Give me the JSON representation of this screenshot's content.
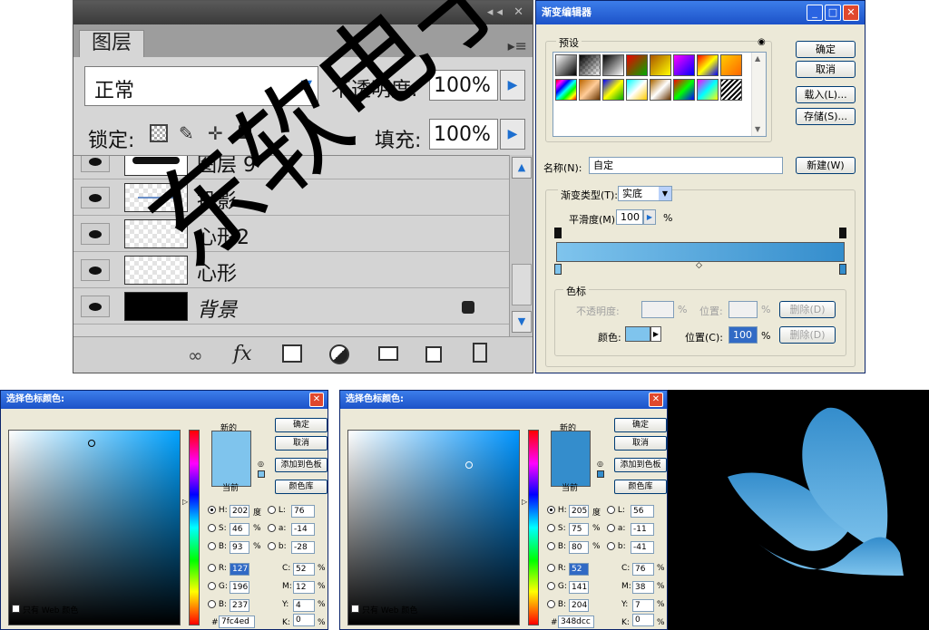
{
  "layers_panel": {
    "tab_label": "图层",
    "blend_mode": "正常",
    "opacity_label": "不透明度:",
    "opacity_value": "100%",
    "lock_label": "锁定:",
    "fill_label": "填充:",
    "fill_value": "100%",
    "layers": [
      {
        "name": "图层 9"
      },
      {
        "name": "投影"
      },
      {
        "name": "心形2"
      },
      {
        "name": "心形"
      },
      {
        "name": "背景"
      }
    ],
    "footer_icons": [
      "link-icon",
      "fx-icon",
      "mask-icon",
      "adjustment-icon",
      "folder-icon",
      "new-layer-icon",
      "trash-icon"
    ]
  },
  "gradient_editor": {
    "title": "渐变编辑器",
    "presets_label": "预设",
    "buttons": {
      "ok": "确定",
      "cancel": "取消",
      "load": "载入(L)...",
      "save": "存储(S)...",
      "new": "新建(W)"
    },
    "name_label": "名称(N):",
    "name_value": "自定",
    "type_label": "渐变类型(T):",
    "type_value": "实底",
    "smooth_label": "平滑度(M):",
    "smooth_value": "100",
    "smooth_unit": "%",
    "stops_group": "色标",
    "opacity_label": "不透明度:",
    "opacity_unit": "%",
    "position_label": "位置:",
    "position_unit": "%",
    "delete_label": "删除(D)",
    "color_label": "颜色:",
    "color_position_label": "位置(C):",
    "color_position_value": "100",
    "color_position_unit": "%",
    "gradient_start": "#7fc4ed",
    "gradient_end": "#348dcc"
  },
  "picker_left": {
    "title": "选择色标颜色:",
    "new_label": "新的",
    "current_label": "当前",
    "buttons": {
      "ok": "确定",
      "cancel": "取消",
      "add": "添加到色板",
      "library": "颜色库"
    },
    "hsb": {
      "H": "202",
      "S": "46",
      "B": "93"
    },
    "hsb_units": {
      "H": "度",
      "S": "%",
      "B": "%"
    },
    "lab": {
      "L": "76",
      "a": "-14",
      "b": "-28"
    },
    "rgb": {
      "R": "127",
      "G": "196",
      "B": "237"
    },
    "cmyk": {
      "C": "52",
      "M": "12",
      "Y": "4",
      "K": "0"
    },
    "cmyk_unit": "%",
    "hex_prefix": "#",
    "hex": "7fc4ed",
    "web_only": "只有 Web 颜色",
    "color": "#7fc4ed"
  },
  "picker_right": {
    "title": "选择色标颜色:",
    "new_label": "新的",
    "current_label": "当前",
    "buttons": {
      "ok": "确定",
      "cancel": "取消",
      "add": "添加到色板",
      "library": "颜色库"
    },
    "hsb": {
      "H": "205",
      "S": "75",
      "B": "80"
    },
    "hsb_units": {
      "H": "度",
      "S": "%",
      "B": "%"
    },
    "lab": {
      "L": "56",
      "a": "-11",
      "b": "-41"
    },
    "rgb": {
      "R": "52",
      "G": "141",
      "B": "204"
    },
    "cmyk": {
      "C": "76",
      "M": "38",
      "Y": "7",
      "K": "0"
    },
    "cmyk_unit": "%",
    "hex_prefix": "#",
    "hex": "348dcc",
    "web_only": "只有 Web 颜色",
    "color": "#348dcc"
  },
  "watermark": "东软电子"
}
